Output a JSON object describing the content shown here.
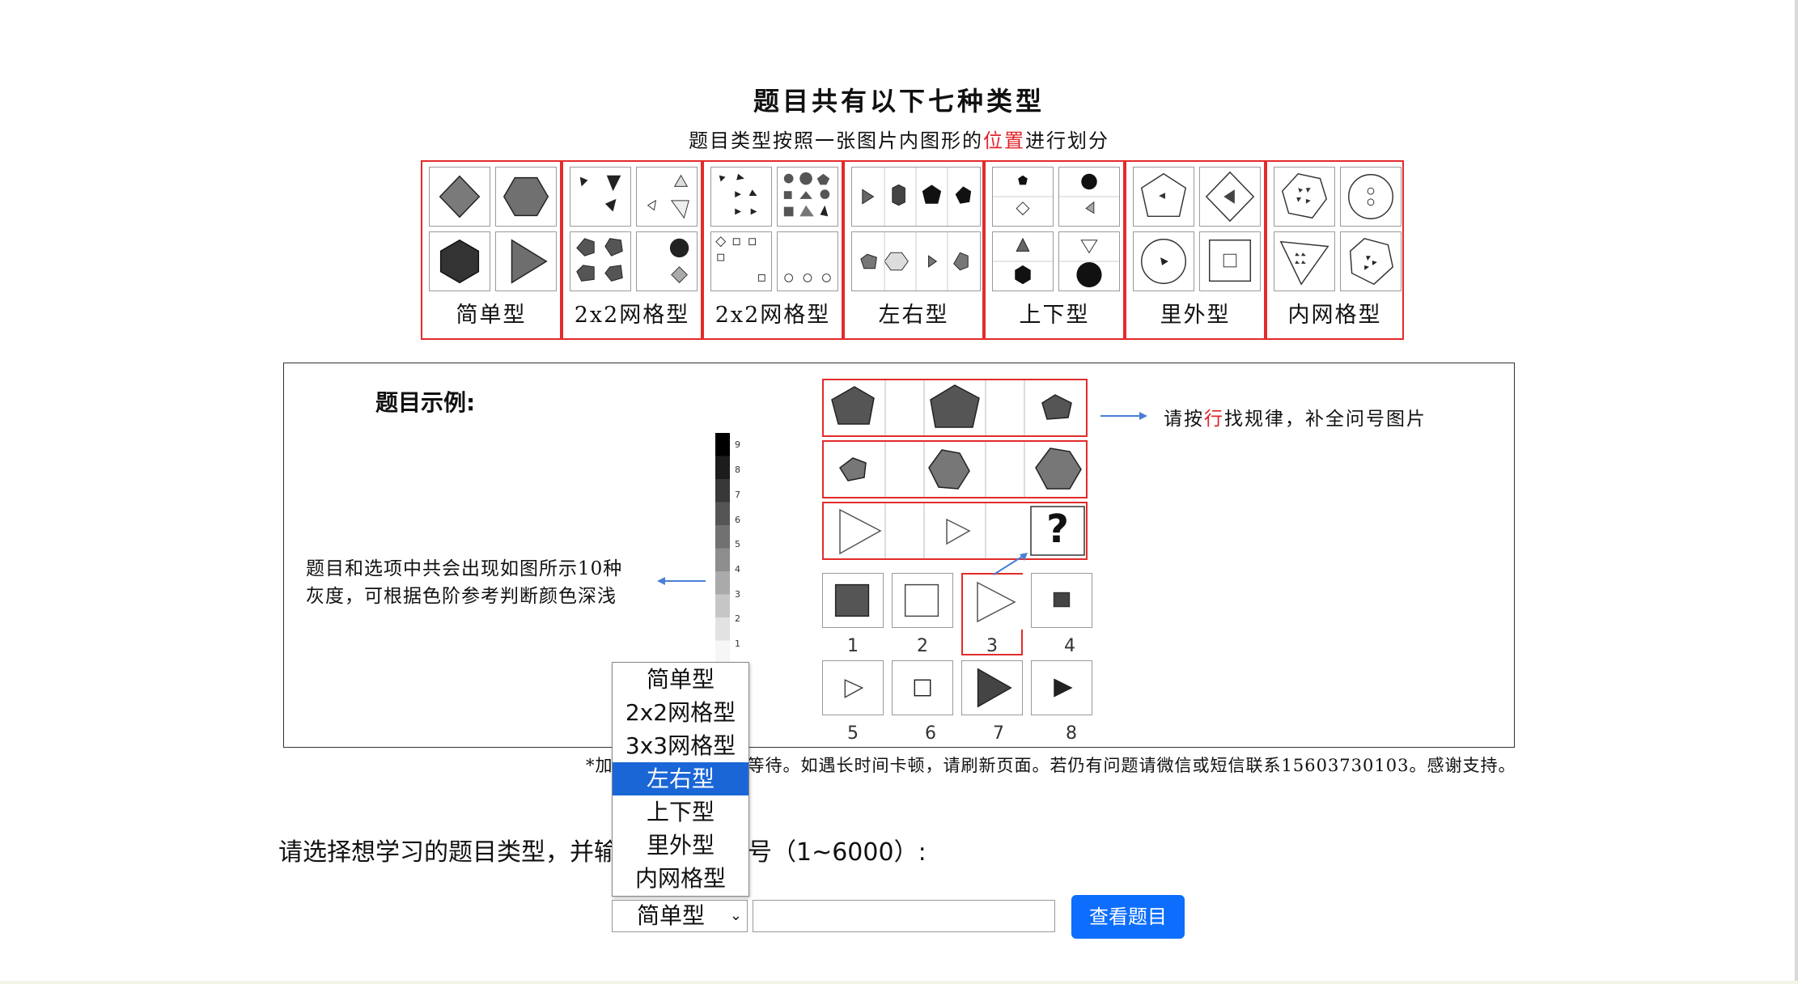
{
  "header": {
    "title": "题目共有以下七种类型",
    "subtitle_pre": "题目类型按照一张图片内图形的",
    "subtitle_highlight": "位置",
    "subtitle_post": "进行划分"
  },
  "type_labels": [
    "简单型",
    "2x2网格型",
    "2x2网格型",
    "左右型",
    "上下型",
    "里外型",
    "内网格型"
  ],
  "example": {
    "title": "题目示例:",
    "gray_note_line1": "题目和选项中共会出现如图所示10种",
    "gray_note_line2": "灰度，可根据色阶参考判断颜色深浅",
    "colorbar_ticks": [
      "9",
      "8",
      "7",
      "6",
      "5",
      "4",
      "3",
      "2",
      "1"
    ],
    "hint_pre": "请按",
    "hint_highlight": "行",
    "hint_post": "找规律，补全问号图片",
    "question_mark": "?",
    "option_numbers": [
      "1",
      "2",
      "3",
      "4",
      "5",
      "6",
      "7",
      "8"
    ]
  },
  "footnote_prefix": "*加",
  "footnote": "等待。如遇长时间卡顿，请刷新页面。若仍有问题请微信或短信联系15603730103。感谢支持。",
  "form": {
    "prompt_pre": "请选择想学习的题目类型，并输",
    "prompt_post": "题号（1~6000）:",
    "selected_value": "简单型",
    "number_value": "",
    "button_label": "查看题目",
    "options": [
      "简单型",
      "2x2网格型",
      "3x3网格型",
      "左右型",
      "上下型",
      "里外型",
      "内网格型"
    ],
    "highlighted_option": "左右型"
  },
  "colors": {
    "frame_red": "#e32b2b",
    "highlight_red": "#e0242a",
    "button_blue": "#0d6efd",
    "dropdown_selected": "#1a66d6",
    "arrow_blue": "#4a7fd4"
  }
}
